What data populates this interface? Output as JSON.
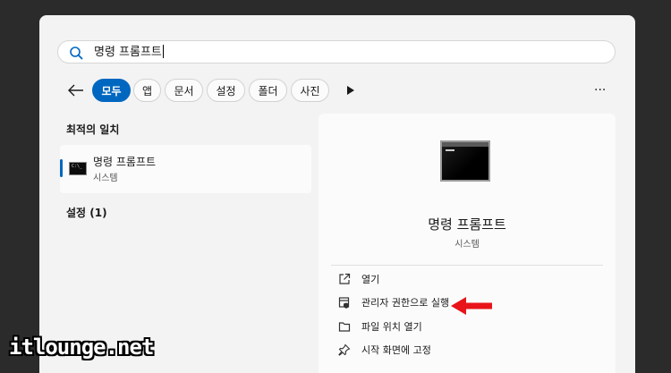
{
  "search": {
    "value": "명령 프롬프트"
  },
  "filters": [
    {
      "label": "모두",
      "active": true
    },
    {
      "label": "앱"
    },
    {
      "label": "문서"
    },
    {
      "label": "설정"
    },
    {
      "label": "폴더"
    },
    {
      "label": "사진"
    }
  ],
  "results": {
    "best_match_header": "최적의 일치",
    "best_match": {
      "name": "명령 프롬프트",
      "type": "시스템"
    },
    "settings_header": "설정 (1)"
  },
  "detail": {
    "name": "명령 프롬프트",
    "type": "시스템",
    "actions": [
      {
        "label": "열기",
        "icon": "open-external-icon"
      },
      {
        "label": "관리자 권한으로 실행",
        "icon": "shield-admin-icon"
      },
      {
        "label": "파일 위치 열기",
        "icon": "folder-icon"
      },
      {
        "label": "시작 화면에 고정",
        "icon": "pin-icon"
      }
    ]
  },
  "annotation": {
    "arrow_color": "#e8141a"
  },
  "watermark": "itlounge.net",
  "colors": {
    "accent": "#0067c0",
    "background": "#2b2b2b",
    "panel": "#f3f3f3"
  }
}
